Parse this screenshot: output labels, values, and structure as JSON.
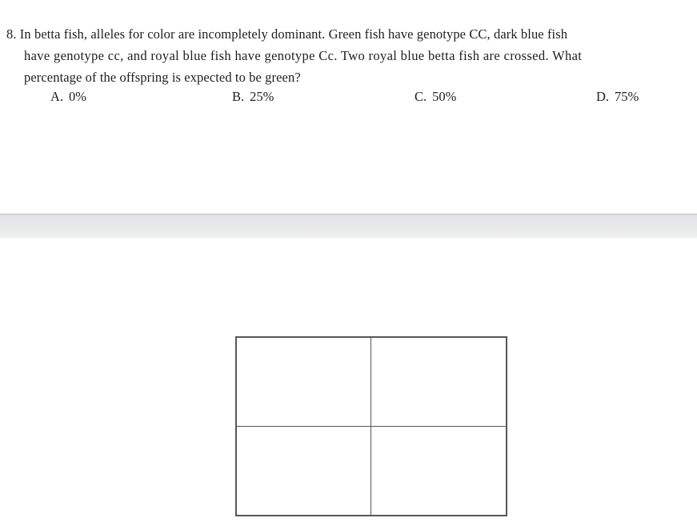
{
  "question": {
    "number": "8.",
    "line1": "8. In betta fish, alleles for color are incompletely dominant.  Green fish have genotype CC, dark blue fish",
    "line2": "have genotype cc, and royal blue fish have genotype Cc.  Two royal blue betta fish are crossed.  What",
    "line3": "percentage of the offspring is expected to be green?",
    "full_text": "8. In betta fish, alleles for color are incompletely dominant. Green fish have genotype CC, dark blue fish have genotype cc, and royal blue fish have genotype Cc. Two royal blue betta fish are crossed. What percentage of the offspring is expected to be green?"
  },
  "choices": [
    {
      "letter": "A.",
      "text": "0%"
    },
    {
      "letter": "B.",
      "text": "25%"
    },
    {
      "letter": "C.",
      "text": "50%"
    },
    {
      "letter": "D.",
      "text": "75%"
    }
  ],
  "punnett": {
    "rows": 2,
    "columns": 2,
    "cells": [
      "",
      "",
      "",
      ""
    ],
    "border_color": "#555759"
  },
  "colors": {
    "page_background": "#ffffff",
    "text": "#1e1e1e",
    "band_line": "#c9cacc",
    "band_fill": "#e9eaec",
    "grid_line": "#555759"
  }
}
